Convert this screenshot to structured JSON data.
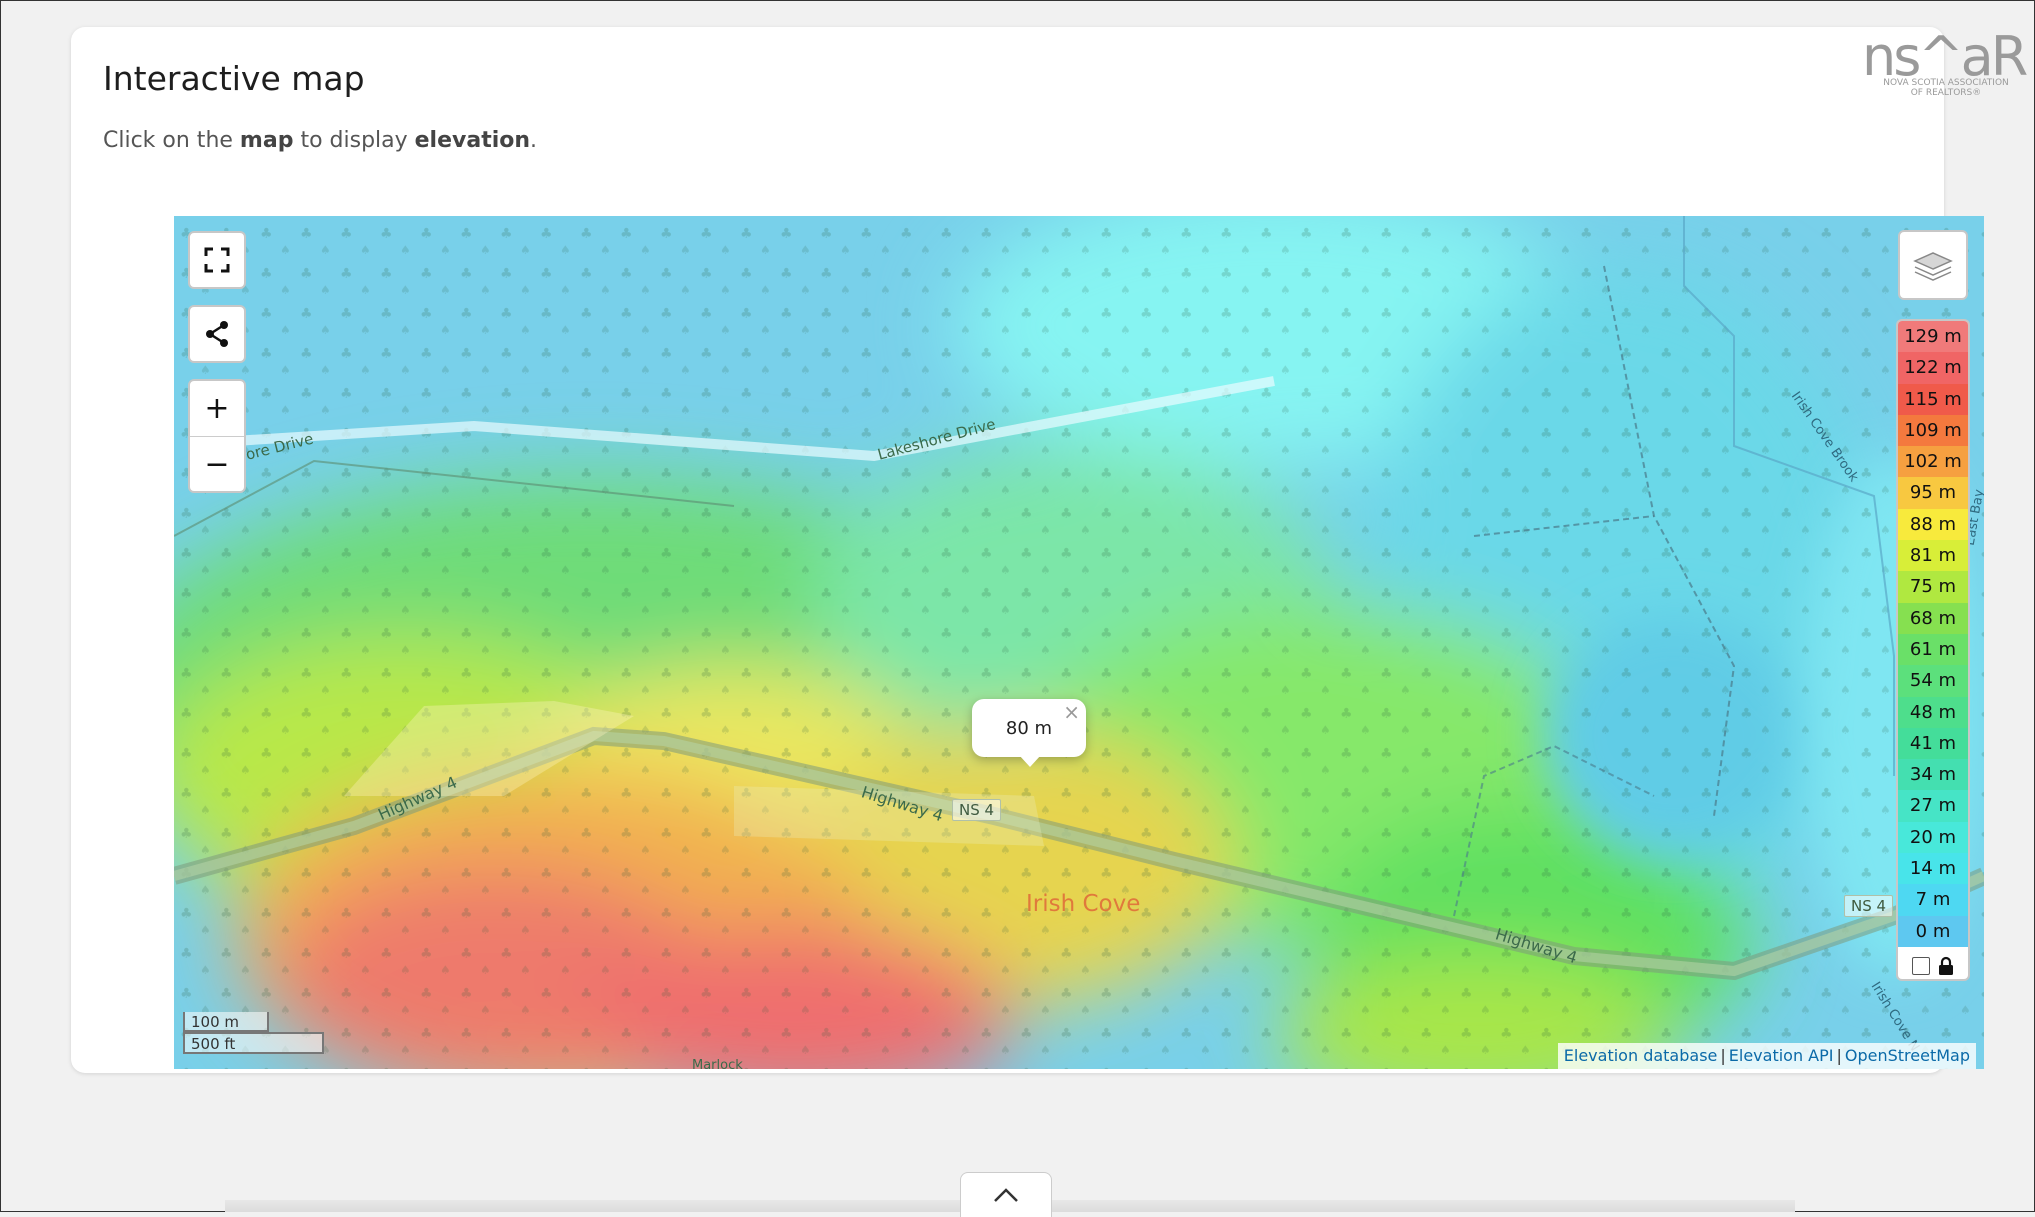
{
  "page": {
    "title": "Interactive map",
    "subtitle": {
      "prefix": "Click on the ",
      "word_map": "map",
      "middle": " to display ",
      "word_elevation": "elevation",
      "suffix": "."
    }
  },
  "logo": {
    "text": "ns^aR",
    "caption": "NOVA SCOTIA ASSOCIATION OF REALTORS®"
  },
  "map": {
    "controls": {
      "fullscreen_icon": "fullscreen-icon",
      "share_icon": "share-icon",
      "zoom_in": "+",
      "zoom_out": "−",
      "layers_icon": "layers-icon"
    },
    "popup": {
      "text": "80 m",
      "close": "×"
    },
    "legend": {
      "values": [
        "129 m",
        "122 m",
        "115 m",
        "109 m",
        "102 m",
        "95 m",
        "88 m",
        "81 m",
        "75 m",
        "68 m",
        "61 m",
        "54 m",
        "48 m",
        "41 m",
        "34 m",
        "27 m",
        "20 m",
        "14 m",
        "7 m",
        "0 m"
      ],
      "colors": [
        "#f07a7a",
        "#f06565",
        "#f05a4a",
        "#f4793e",
        "#f6a040",
        "#f8c840",
        "#f8ea3c",
        "#d8ee38",
        "#b0e840",
        "#86e050",
        "#6ae068",
        "#5ce07c",
        "#4ede8c",
        "#44dd9a",
        "#44dfb0",
        "#46e4c6",
        "#48e8da",
        "#48e4ea",
        "#4ed8f2",
        "#5ec8f0"
      ],
      "lock_icon": "lock-icon"
    },
    "labels": {
      "lakeshore_left": "ore Drive",
      "lakeshore": "Lakeshore Drive",
      "highway_left": "Highway 4",
      "highway_mid": "Highway 4",
      "highway_right": "Highway 4",
      "ns4_mid": "NS 4",
      "ns4_right": "NS 4",
      "brook": "Irish Cove Brook",
      "brook2": "Irish Cove N",
      "east": "East Bay",
      "place": "Irish Cove",
      "bottom_partial": "Marlock"
    },
    "scale": {
      "metric": "100 m",
      "imperial": "500 ft"
    },
    "attribution": [
      "Elevation database",
      "Elevation API",
      "OpenStreetMap"
    ]
  },
  "bottom_tab": {
    "icon": "chevron-up-icon"
  }
}
